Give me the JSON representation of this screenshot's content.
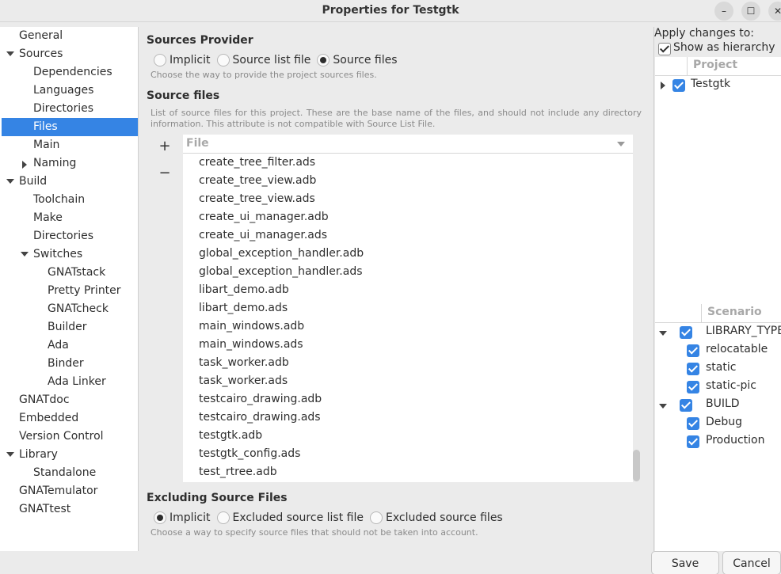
{
  "window": {
    "title": "Properties for Testgtk",
    "minimize_glyph": "–",
    "maximize_glyph": "☐",
    "close_glyph": "✕"
  },
  "nav": {
    "items": [
      {
        "label": "General"
      },
      {
        "label": "Sources"
      },
      {
        "label": "Dependencies"
      },
      {
        "label": "Languages"
      },
      {
        "label": "Directories"
      },
      {
        "label": "Files"
      },
      {
        "label": "Main"
      },
      {
        "label": "Naming"
      },
      {
        "label": "Build"
      },
      {
        "label": "Toolchain"
      },
      {
        "label": "Make"
      },
      {
        "label": "Directories"
      },
      {
        "label": "Switches"
      },
      {
        "label": "GNATstack"
      },
      {
        "label": "Pretty Printer"
      },
      {
        "label": "GNATcheck"
      },
      {
        "label": "Builder"
      },
      {
        "label": "Ada"
      },
      {
        "label": "Binder"
      },
      {
        "label": "Ada Linker"
      },
      {
        "label": "GNATdoc"
      },
      {
        "label": "Embedded"
      },
      {
        "label": "Version Control"
      },
      {
        "label": "Library"
      },
      {
        "label": "Standalone"
      },
      {
        "label": "GNATemulator"
      },
      {
        "label": "GNATtest"
      }
    ]
  },
  "sources_provider": {
    "title": "Sources Provider",
    "options": [
      "Implicit",
      "Source list file",
      "Source files"
    ],
    "selected": "Source files",
    "help": "Choose the way to provide the project sources files."
  },
  "source_files": {
    "title": "Source files",
    "help": "List of source files for this project. These are the base name of the files, and should not include any directory information. This attribute is not compatible with Source List File.",
    "add_glyph": "+",
    "remove_glyph": "−",
    "column_header": "File",
    "files": [
      "create_tree_filter.ads",
      "create_tree_view.adb",
      "create_tree_view.ads",
      "create_ui_manager.adb",
      "create_ui_manager.ads",
      "global_exception_handler.adb",
      "global_exception_handler.ads",
      "libart_demo.adb",
      "libart_demo.ads",
      "main_windows.adb",
      "main_windows.ads",
      "task_worker.adb",
      "task_worker.ads",
      "testcairo_drawing.adb",
      "testcairo_drawing.ads",
      "testgtk.adb",
      "testgtk_config.ads",
      "test_rtree.adb"
    ]
  },
  "excluding": {
    "title": "Excluding Source Files",
    "options": [
      "Implicit",
      "Excluded source list file",
      "Excluded source files"
    ],
    "selected": "Implicit",
    "help": "Choose a way to specify source files that should not be taken into account."
  },
  "side": {
    "apply_label": "Apply changes to:",
    "hierarchy_label": "Show as hierarchy",
    "project_header": "Project",
    "project": "Testgtk",
    "scenario_header": "Scenario",
    "scenario": [
      {
        "label": "LIBRARY_TYPE",
        "level": 0
      },
      {
        "label": "relocatable",
        "level": 1
      },
      {
        "label": "static",
        "level": 1
      },
      {
        "label": "static-pic",
        "level": 1
      },
      {
        "label": "BUILD",
        "level": 0
      },
      {
        "label": "Debug",
        "level": 1
      },
      {
        "label": "Production",
        "level": 1
      }
    ]
  },
  "footer": {
    "save": "Save",
    "cancel": "Cancel"
  },
  "colors": {
    "accent": "#3584e4",
    "help_text": "#8a8a8a"
  }
}
